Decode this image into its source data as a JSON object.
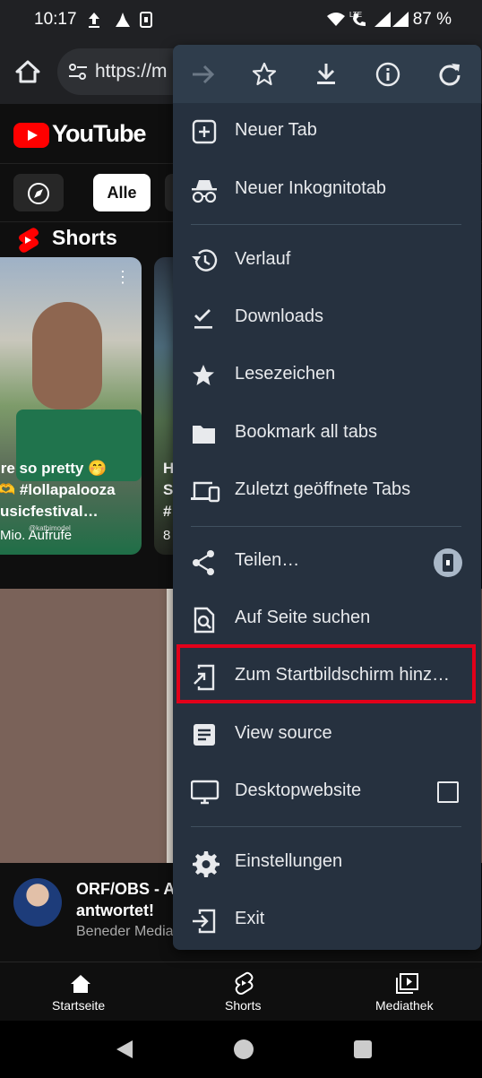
{
  "status_bar": {
    "time": "10:17",
    "battery": "87 %"
  },
  "url_bar": {
    "url_text": "https://m"
  },
  "youtube": {
    "logo": "YouTube",
    "chip_all": "Alle",
    "shorts_title": "Shorts",
    "short1": {
      "line1": "’re so pretty 🤭",
      "line2": "🫶 #lollapalooza",
      "line3": "usicfestival…",
      "views": "Mio. Aufrufe",
      "watermark": "@kathimodel"
    },
    "short2": {
      "line1": "H",
      "line2": "S",
      "line3": "#",
      "views": "8"
    },
    "video": {
      "title_line1": "ORF/OBS - A",
      "title_line2": "antwortet!",
      "channel": "Beneder Media"
    }
  },
  "bottom_nav": {
    "home": "Startseite",
    "shorts": "Shorts",
    "library": "Mediathek"
  },
  "menu": {
    "toolbar": [
      "forward-icon",
      "bookmark-star-icon",
      "download-icon",
      "info-icon",
      "reload-icon"
    ],
    "items": [
      {
        "label": "Neuer Tab",
        "icon": "new-tab-icon"
      },
      {
        "label": "Neuer Inkognitotab",
        "icon": "incognito-icon"
      },
      {
        "label": "Verlauf",
        "icon": "history-icon"
      },
      {
        "label": "Downloads",
        "icon": "downloads-icon"
      },
      {
        "label": "Lesezeichen",
        "icon": "star-icon"
      },
      {
        "label": "Bookmark all tabs",
        "icon": "folder-icon"
      },
      {
        "label": "Zuletzt geöffnete Tabs",
        "icon": "devices-icon"
      },
      {
        "label": "Teilen…",
        "icon": "share-icon"
      },
      {
        "label": "Auf Seite suchen",
        "icon": "find-in-page-icon"
      },
      {
        "label": "Zum Startbildschirm hinz…",
        "icon": "add-to-home-icon"
      },
      {
        "label": "View source",
        "icon": "article-icon"
      },
      {
        "label": "Desktopwebsite",
        "icon": "desktop-icon"
      },
      {
        "label": "Einstellungen",
        "icon": "gear-icon"
      },
      {
        "label": "Exit",
        "icon": "exit-icon"
      }
    ],
    "desktop_checkbox_checked": false
  },
  "colors": {
    "menu_bg": "#26313f",
    "highlight": "#e2001a",
    "yt_red": "#ff0000"
  }
}
